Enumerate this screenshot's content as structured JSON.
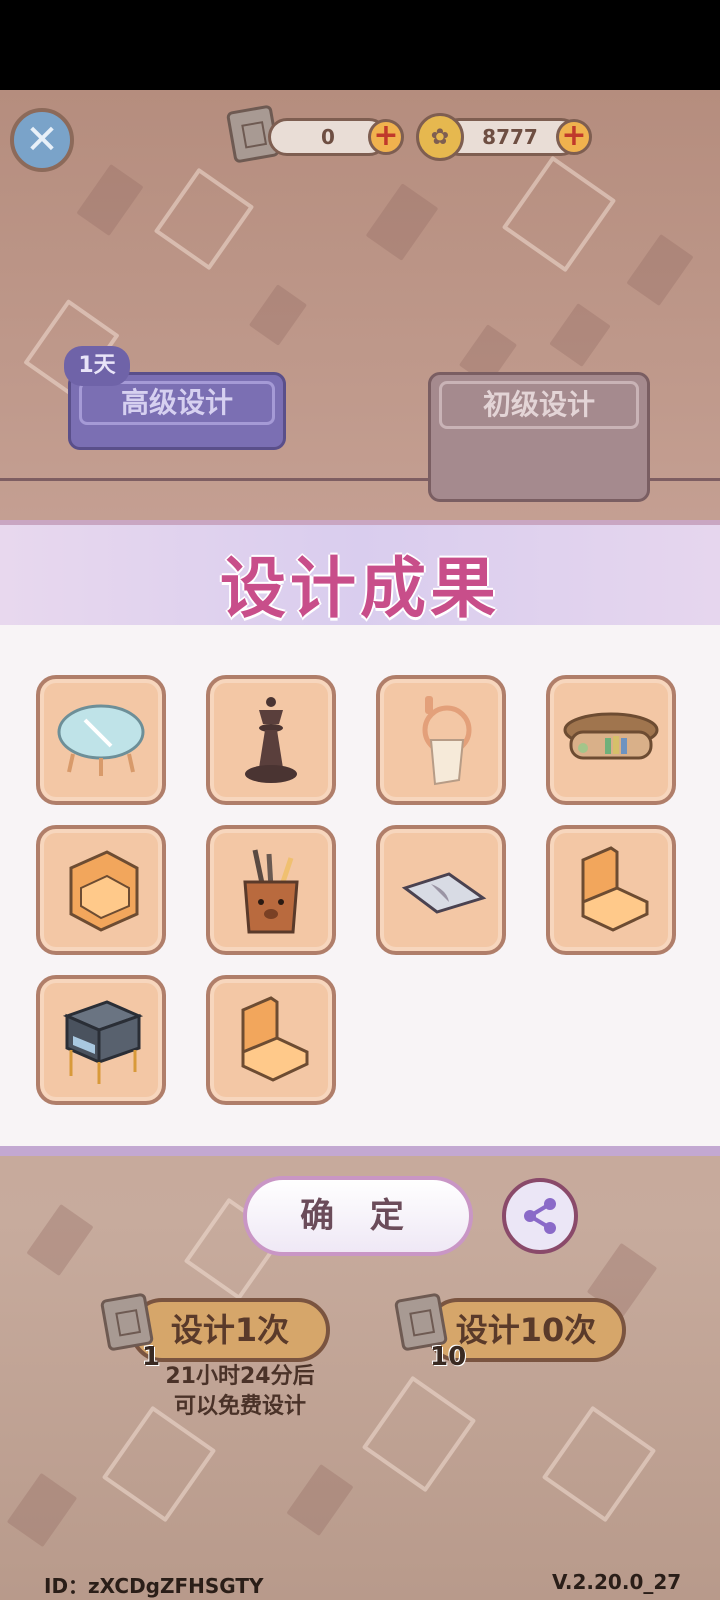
{
  "topbar": {
    "scrolls": "0",
    "coins": "8777"
  },
  "tabs": {
    "advanced_label": "高级设计",
    "advanced_badge": "1天",
    "basic_label": "初级设计"
  },
  "modal": {
    "title": "设计成果",
    "items": [
      {
        "name": "glass-table"
      },
      {
        "name": "chess-queen"
      },
      {
        "name": "towel-ring"
      },
      {
        "name": "oval-bookshelf"
      },
      {
        "name": "corner-sofa"
      },
      {
        "name": "pen-holder"
      },
      {
        "name": "rug"
      },
      {
        "name": "armless-chair"
      },
      {
        "name": "nightstand"
      },
      {
        "name": "armless-chair"
      }
    ]
  },
  "actions": {
    "confirm_label": "确 定",
    "design_once_label": "设计1次",
    "design_once_cost": "1",
    "design_ten_label": "设计10次",
    "design_ten_cost": "10",
    "free_timer_line1": "21小时24分后",
    "free_timer_line2": "可以免费设计"
  },
  "footer": {
    "id_text": "ID：zXCDgZFHSGTY",
    "version": "V.2.20.0_27"
  },
  "colors": {
    "title": "#c84e8a",
    "item_bg": "#f3c7a5",
    "advanced_tab": "#7b6fb3",
    "design_button": "#d6a66a"
  }
}
